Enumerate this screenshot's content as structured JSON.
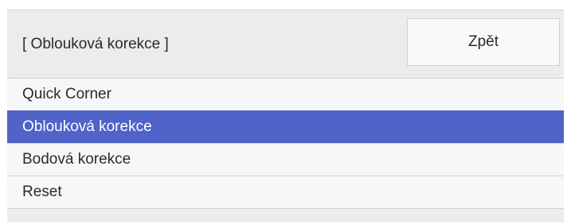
{
  "header": {
    "title": "[ Oblouková korekce ]",
    "back_label": "Zpět"
  },
  "menu": {
    "selected_index": 1,
    "items": [
      {
        "label": "Quick Corner"
      },
      {
        "label": "Oblouková korekce"
      },
      {
        "label": "Bodová korekce"
      },
      {
        "label": "Reset"
      }
    ]
  },
  "colors": {
    "selection": "#4f63c9",
    "panel_background": "#ececec",
    "item_background": "#f7f7f7",
    "text": "#2b2b2b"
  }
}
